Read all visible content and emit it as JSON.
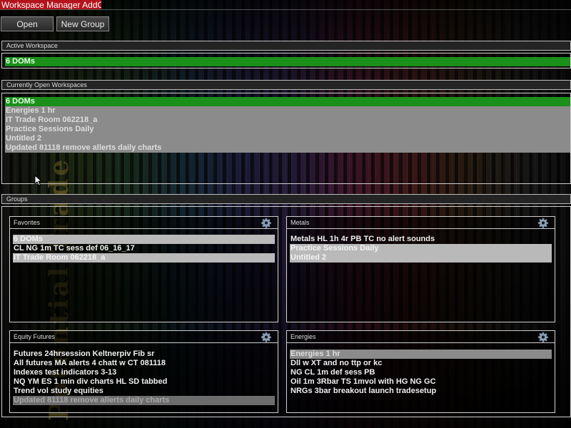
{
  "window": {
    "title": "Workspace Manager AddOn"
  },
  "toolbar": {
    "open_label": "Open",
    "new_group_label": "New Group"
  },
  "active_workspace": {
    "header": "Active Workspace",
    "value": "6 DOMs"
  },
  "open_workspaces": {
    "header": "Currently Open Workspaces",
    "items": [
      {
        "label": "6 DOMs"
      },
      {
        "label": "Energies 1 hr"
      },
      {
        "label": "IT Trade Room 062218_a"
      },
      {
        "label": "Practice Sessions Daily"
      },
      {
        "label": "Untitled 2"
      },
      {
        "label": "Updated 81118 remove allerts daily charts"
      }
    ]
  },
  "groups": {
    "header": "Groups",
    "favorites": {
      "title": "Favorites",
      "items": [
        {
          "label": "6 DOMs"
        },
        {
          "label": "CL NG 1m TC sess def 06_16_17"
        },
        {
          "label": "IT Trade Room 062218_a"
        }
      ]
    },
    "metals": {
      "title": "Metals",
      "items": [
        {
          "label": "Metals HL 1h 4r PB TC no alert sounds"
        },
        {
          "label": "Practice Sessions Daily"
        },
        {
          "label": "Untitled 2"
        }
      ]
    },
    "equity_futures": {
      "title": "Equity Futures",
      "items": [
        {
          "label": "Futures 24hrsession Keltnerpiv Fib sr"
        },
        {
          "label": "All futures MA alerts 4 chatt w CT 081118"
        },
        {
          "label": "Indexes test indicators 3-13"
        },
        {
          "label": "NQ YM ES 1 min div charts HL SD tabbed"
        },
        {
          "label": "Trend vol study equities"
        },
        {
          "label": "Updated 81118 remove allerts daily charts"
        }
      ]
    },
    "energies": {
      "title": "Energies",
      "items": [
        {
          "label": "Energies 1 hr"
        },
        {
          "label": "Dll w XT and no ttp or kc"
        },
        {
          "label": "NG CL 1m def sess PB"
        },
        {
          "label": "Oil 1m 3Rbar TS 1mvol with HG NG GC"
        },
        {
          "label": "NRGs 3bar breakout launch tradesetup"
        }
      ]
    }
  },
  "watermark": "Potential Trade",
  "icons": {
    "settings": "gear-icon",
    "pointer": "mouse-cursor-icon"
  },
  "colors": {
    "title_bar": "#b3131a",
    "active_selection": "#1a8f1a",
    "selection_gray": "#8b8b8b"
  }
}
